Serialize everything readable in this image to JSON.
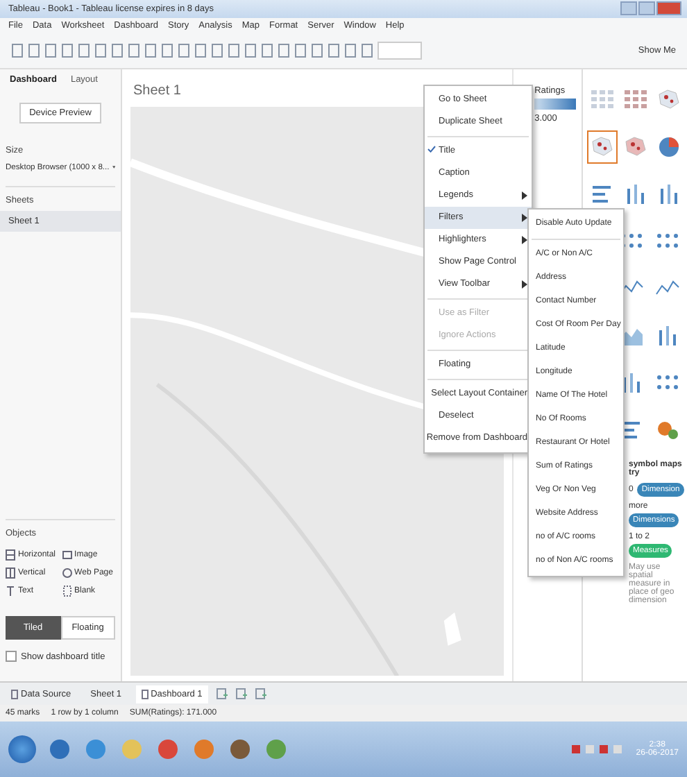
{
  "window": {
    "title": "Tableau - Book1 - Tableau license expires in 8 days"
  },
  "menu_bar": [
    "File",
    "Data",
    "Worksheet",
    "Dashboard",
    "Story",
    "Analysis",
    "Map",
    "Format",
    "Server",
    "Window",
    "Help"
  ],
  "show_me_button": {
    "label": "Show Me"
  },
  "left_panel": {
    "tabs": [
      {
        "label": "Dashboard",
        "selected": true
      },
      {
        "label": "Layout",
        "selected": false
      }
    ],
    "device_preview": "Device Preview",
    "size_heading": "Size",
    "size_value": "Desktop Browser (1000 x 8...",
    "sheets_heading": "Sheets",
    "sheets": [
      {
        "label": "Sheet 1",
        "selected": true
      }
    ],
    "objects_heading": "Objects",
    "objects": [
      {
        "label": "Horizontal",
        "kind": "horizontal"
      },
      {
        "label": "Image",
        "kind": "image"
      },
      {
        "label": "Vertical",
        "kind": "vertical"
      },
      {
        "label": "Web Page",
        "kind": "web"
      },
      {
        "label": "Text",
        "kind": "text"
      },
      {
        "label": "Blank",
        "kind": "blank"
      }
    ],
    "layout_modes": [
      {
        "label": "Tiled",
        "selected": true
      },
      {
        "label": "Floating",
        "selected": false
      }
    ],
    "show_title": {
      "label": "Show dashboard title",
      "checked": false
    }
  },
  "canvas": {
    "title": "Sheet 1"
  },
  "legend": {
    "title": "Ratings",
    "value": "3.000"
  },
  "context_menu": {
    "items": [
      {
        "kind": "item",
        "label": "Go to Sheet",
        "checked": false,
        "disabled": false,
        "selected": false,
        "submenu": false
      },
      {
        "kind": "item",
        "label": "Duplicate Sheet",
        "checked": false,
        "disabled": false,
        "selected": false,
        "submenu": false
      },
      {
        "kind": "separator"
      },
      {
        "kind": "item",
        "label": "Title",
        "checked": true,
        "disabled": false,
        "selected": false,
        "submenu": false
      },
      {
        "kind": "item",
        "label": "Caption",
        "checked": false,
        "disabled": false,
        "selected": false,
        "submenu": false
      },
      {
        "kind": "item",
        "label": "Legends",
        "checked": false,
        "disabled": false,
        "selected": false,
        "submenu": true
      },
      {
        "kind": "item",
        "label": "Filters",
        "checked": false,
        "disabled": false,
        "selected": true,
        "submenu": true
      },
      {
        "kind": "item",
        "label": "Highlighters",
        "checked": false,
        "disabled": false,
        "selected": false,
        "submenu": true
      },
      {
        "kind": "item",
        "label": "Show Page Control",
        "checked": false,
        "disabled": false,
        "selected": false,
        "submenu": false
      },
      {
        "kind": "item",
        "label": "View Toolbar",
        "checked": false,
        "disabled": false,
        "selected": false,
        "submenu": true
      },
      {
        "kind": "separator"
      },
      {
        "kind": "item",
        "label": "Use as Filter",
        "checked": false,
        "disabled": true,
        "selected": false,
        "submenu": false
      },
      {
        "kind": "item",
        "label": "Ignore Actions",
        "checked": false,
        "disabled": true,
        "selected": false,
        "submenu": false
      },
      {
        "kind": "separator"
      },
      {
        "kind": "item",
        "label": "Floating",
        "checked": false,
        "disabled": false,
        "selected": false,
        "submenu": false
      },
      {
        "kind": "separator"
      },
      {
        "kind": "item",
        "label": "Select Layout Container",
        "checked": false,
        "disabled": false,
        "selected": false,
        "submenu": false
      },
      {
        "kind": "item",
        "label": "Deselect",
        "checked": false,
        "disabled": false,
        "selected": false,
        "submenu": false
      },
      {
        "kind": "item",
        "label": "Remove from Dashboard",
        "checked": false,
        "disabled": false,
        "selected": false,
        "submenu": false
      }
    ]
  },
  "filters_submenu": {
    "items": [
      {
        "kind": "item",
        "label": "Disable Auto Update"
      },
      {
        "kind": "separator"
      },
      {
        "kind": "item",
        "label": "A/C or Non A/C"
      },
      {
        "kind": "item",
        "label": "Address"
      },
      {
        "kind": "item",
        "label": "Contact Number"
      },
      {
        "kind": "item",
        "label": "Cost Of Room Per Day"
      },
      {
        "kind": "item",
        "label": "Latitude"
      },
      {
        "kind": "item",
        "label": "Longitude"
      },
      {
        "kind": "item",
        "label": "Name Of The Hotel"
      },
      {
        "kind": "item",
        "label": "No Of Rooms"
      },
      {
        "kind": "item",
        "label": "Restaurant Or Hotel"
      },
      {
        "kind": "item",
        "label": "Sum of Ratings"
      },
      {
        "kind": "item",
        "label": "Veg Or Non Veg"
      },
      {
        "kind": "item",
        "label": "Website Address"
      },
      {
        "kind": "item",
        "label": "no of A/C rooms"
      },
      {
        "kind": "item",
        "label": "no of Non A/C rooms"
      }
    ]
  },
  "show_me_panel": {
    "thumbnail_rows": [
      [
        {
          "kind": "table",
          "selected": false
        },
        {
          "kind": "heatmap",
          "selected": false
        },
        {
          "kind": "map",
          "selected": false
        }
      ],
      [
        {
          "kind": "symbol_map",
          "selected": true
        },
        {
          "kind": "filled_map",
          "selected": false
        },
        {
          "kind": "pie",
          "selected": false
        }
      ],
      [
        {
          "kind": "hbar",
          "selected": false
        },
        {
          "kind": "stacked_bar",
          "selected": false
        },
        {
          "kind": "side_bar",
          "selected": false
        }
      ],
      [
        {
          "kind": "circles",
          "selected": false
        },
        {
          "kind": "side_circles",
          "selected": false
        }
      ],
      [
        {
          "kind": "line_discrete",
          "selected": false
        },
        {
          "kind": "dual_line",
          "selected": false
        }
      ],
      [
        {
          "kind": "area_discrete",
          "selected": false
        },
        {
          "kind": "dual_combo",
          "selected": false
        }
      ],
      [
        {
          "kind": "histogram",
          "selected": false
        },
        {
          "kind": "boxplot",
          "selected": false
        }
      ],
      [
        {
          "kind": "bullet",
          "selected": false
        },
        {
          "kind": "bubbles",
          "selected": false
        }
      ]
    ],
    "hint_title": "symbol maps try",
    "requirements": [
      {
        "count": "0",
        "pill": "Dimension",
        "kind": "dimension"
      },
      {
        "count": "more",
        "pill": "Dimensions",
        "kind": "dimension"
      },
      {
        "count": "1 to 2",
        "pill": "Measures",
        "kind": "measure"
      }
    ],
    "note": "May use spatial measure in place of geo dimension"
  },
  "sheet_tabs": [
    {
      "label": "Data Source",
      "kind": "source",
      "selected": false
    },
    {
      "label": "Sheet 1",
      "kind": "sheet",
      "selected": false
    },
    {
      "label": "Dashboard 1",
      "kind": "dashboard",
      "selected": true
    }
  ],
  "status_bar": [
    "45 marks",
    "1 row by 1 column",
    "SUM(Ratings): 171.000"
  ],
  "taskbar": {
    "time": "2:38",
    "date": "26-06-2017"
  }
}
